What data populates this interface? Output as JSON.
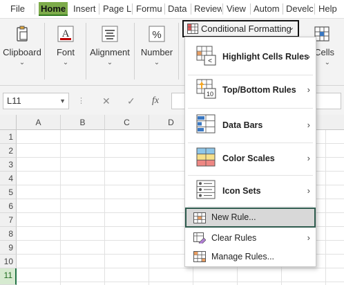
{
  "tabs": [
    {
      "label": "File"
    },
    {
      "label": "Home"
    },
    {
      "label": "Insert"
    },
    {
      "label": "Page L"
    },
    {
      "label": "Formu"
    },
    {
      "label": "Data"
    },
    {
      "label": "Review"
    },
    {
      "label": "View"
    },
    {
      "label": "Autom"
    },
    {
      "label": "Develc"
    },
    {
      "label": "Help"
    }
  ],
  "ribbon": {
    "groups": [
      {
        "label": "Clipboard"
      },
      {
        "label": "Font"
      },
      {
        "label": "Alignment"
      },
      {
        "label": "Number"
      },
      {
        "label": "Cells"
      }
    ],
    "font_icon_glyph": "A",
    "number_icon_glyph": "%",
    "conditional_formatting_label": "Conditional Formatting",
    "chevron": "⌄"
  },
  "formula_bar": {
    "name_box_value": "L11",
    "cancel_glyph": "✕",
    "enter_glyph": "✓",
    "fx_glyph": "fx",
    "formula_value": ""
  },
  "grid": {
    "columns": [
      "A",
      "B",
      "C",
      "D"
    ],
    "rows": [
      "1",
      "2",
      "3",
      "4",
      "5",
      "6",
      "7",
      "8",
      "9",
      "10",
      "11"
    ],
    "active_row": "11"
  },
  "menu": {
    "items": [
      {
        "label": "Highlight Cells Rules",
        "has_submenu": true
      },
      {
        "label": "Top/Bottom Rules",
        "has_submenu": true
      },
      {
        "label": "Data Bars",
        "has_submenu": true
      },
      {
        "label": "Color Scales",
        "has_submenu": true
      },
      {
        "label": "Icon Sets",
        "has_submenu": true
      },
      {
        "label": "New Rule...",
        "has_submenu": false
      },
      {
        "label": "Clear Rules",
        "has_submenu": true
      },
      {
        "label": "Manage Rules...",
        "has_submenu": false
      }
    ],
    "submenu_arrow": "›",
    "top_bottom_icon_number": "10"
  },
  "colors": {
    "active_tab": "#7dab4a",
    "excel_green": "#217346",
    "highlight_border": "#2e5b4e"
  }
}
